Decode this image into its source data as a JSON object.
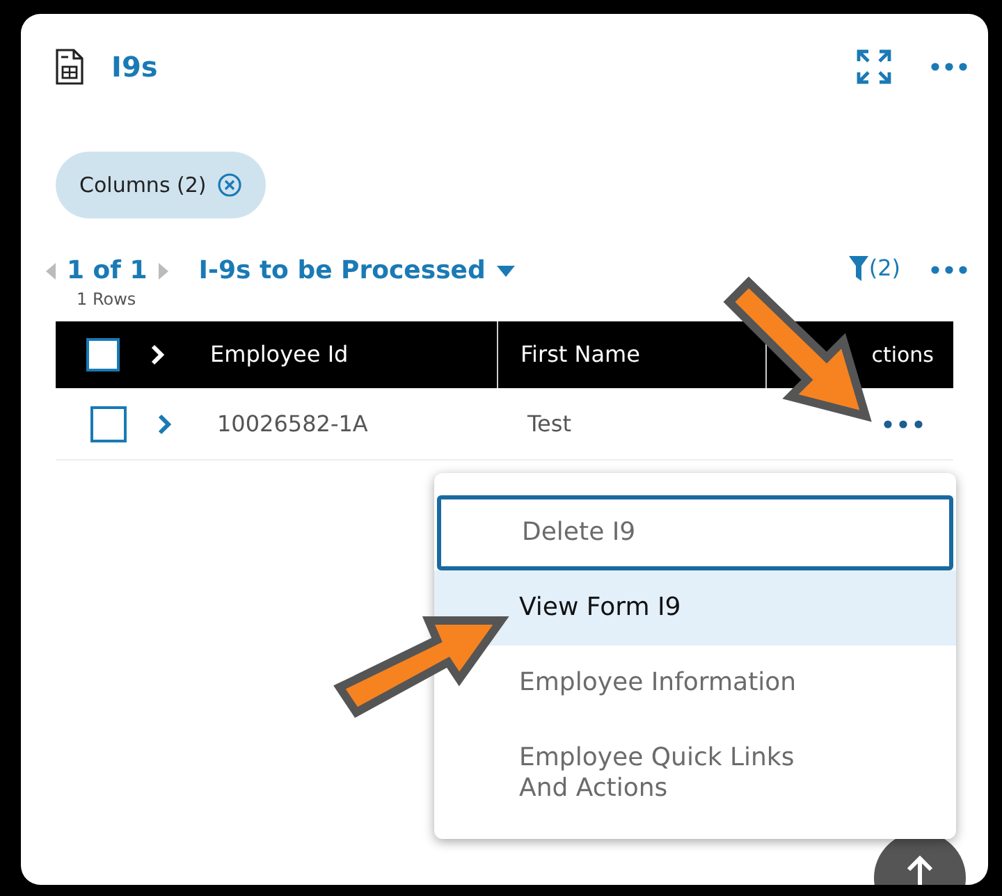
{
  "panel": {
    "title": "I9s"
  },
  "chips": [
    {
      "label": "Columns (2)"
    }
  ],
  "pager": {
    "label": "1 of 1",
    "rows": "1 Rows",
    "view": "I-9s to be Processed",
    "filter_count": "(2)"
  },
  "table": {
    "select_all_checked": false,
    "columns": [
      {
        "label": "Employee Id"
      },
      {
        "label": "First Name"
      },
      {
        "label": "ctions"
      }
    ],
    "rows": [
      {
        "checked": false,
        "employee_id": "10026582-1A",
        "first_name": "Test"
      }
    ]
  },
  "menu": {
    "items": [
      {
        "label": "Delete I9",
        "focused": true,
        "selected": false
      },
      {
        "label": "View Form I9",
        "focused": false,
        "selected": true
      },
      {
        "label": "Employee Information",
        "focused": false,
        "selected": false
      },
      {
        "label": "Employee Quick Links\nAnd Actions",
        "focused": false,
        "selected": false
      }
    ]
  }
}
